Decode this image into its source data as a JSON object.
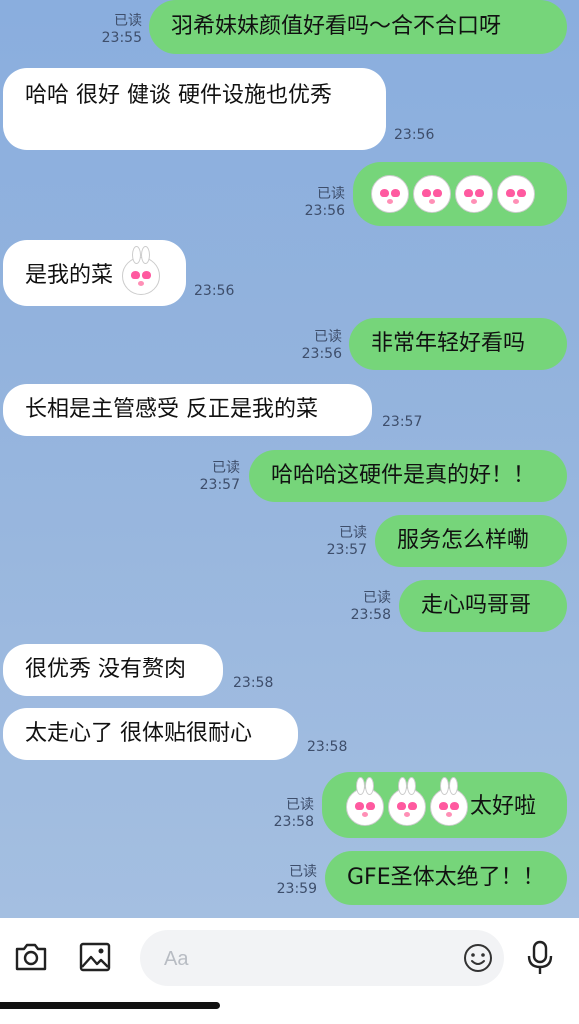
{
  "read_label": "已读",
  "messages": [
    {
      "dir": "out",
      "text": "羽希妹妹颜值好看吗～合不合口呀",
      "time": "23:55"
    },
    {
      "dir": "in",
      "text": "哈哈 很好 健谈 硬件设施也优秀",
      "time": "23:56"
    },
    {
      "dir": "out",
      "text": "",
      "time": "23:56",
      "stickers": 4,
      "sticker": "heart-eyes-face"
    },
    {
      "dir": "in",
      "text": "是我的菜",
      "time": "23:56",
      "sticker": "bunny"
    },
    {
      "dir": "out",
      "text": "非常年轻好看吗",
      "time": "23:56"
    },
    {
      "dir": "in",
      "text": "长相是主管感受 反正是我的菜",
      "time": "23:57"
    },
    {
      "dir": "out",
      "text": "哈哈哈这硬件是真的好！！",
      "time": "23:57"
    },
    {
      "dir": "out",
      "text": "服务怎么样嘞",
      "time": "23:57"
    },
    {
      "dir": "out",
      "text": "走心吗哥哥",
      "time": "23:58"
    },
    {
      "dir": "in",
      "text": "很优秀 没有赘肉",
      "time": "23:58"
    },
    {
      "dir": "in",
      "text": "太走心了 很体贴很耐心",
      "time": "23:58"
    },
    {
      "dir": "out",
      "text": "太好啦",
      "time": "23:58",
      "stickers": 3,
      "sticker": "bunny-heart-eyes"
    },
    {
      "dir": "out",
      "text": "GFE圣体太绝了！！",
      "time": "23:59"
    }
  ],
  "input": {
    "placeholder": "Aa",
    "value": ""
  },
  "toolbar": {
    "icons": [
      "camera-icon",
      "image-icon",
      "emoji-icon",
      "microphone-icon"
    ]
  },
  "colors": {
    "outgoing": "#76d57a",
    "incoming": "#ffffff",
    "background": "#8fb0db"
  }
}
